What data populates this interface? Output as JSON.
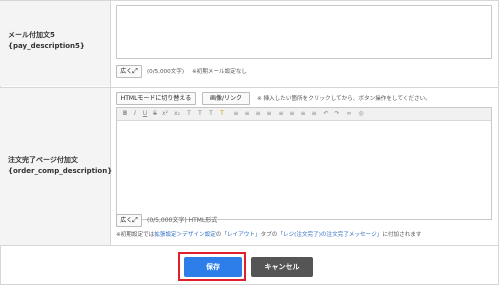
{
  "rows": {
    "mail": {
      "label_line1": "メール付加文5",
      "label_line2": "{pay_description5}",
      "expand_label": "広く",
      "char_count": "(0/5,000文字)",
      "note": "※初期メール設定なし"
    },
    "order": {
      "label_line1": "注文完了ページ付加文",
      "label_line2": "{order_comp_description}",
      "html_mode_button": "HTMLモードに切り替える",
      "image_link_button": "画像/リンク",
      "insert_hint": "※ 挿入したい箇所をクリックしてから、ボタン操作をしてください。",
      "expand_label": "広く",
      "char_count": "(0/5,000文字) HTML形式",
      "footnote_prefix": "※初期設定では",
      "footnote_link1": "拡張設定＞デザイン設定",
      "footnote_mid1": "の",
      "footnote_link2": "「レイアウト」",
      "footnote_mid2": "タブの",
      "footnote_link3": "「レジ(注文完了)の注文完了メッセージ」",
      "footnote_suffix": "に付加されます"
    }
  },
  "toolbar_icons": [
    "B",
    "I",
    "U",
    "S",
    "x²",
    "x₂",
    "T",
    "T",
    "T",
    "T",
    "≡",
    "≡",
    "≡",
    "≡",
    "≡",
    "≡",
    "≡",
    "≡",
    "↶",
    "↷",
    "∞",
    "◎"
  ],
  "toolbar_icon_names": [
    "bold-icon",
    "italic-icon",
    "underline-icon",
    "strikethrough-icon",
    "superscript-icon",
    "subscript-icon",
    "font-size-icon",
    "font-color-icon",
    "text-color-icon",
    "highlight-icon",
    "ordered-list-icon",
    "unordered-list-icon",
    "indent-icon",
    "outdent-icon",
    "align-left-icon",
    "align-center-icon",
    "align-right-icon",
    "align-justify-icon",
    "undo-icon",
    "redo-icon",
    "link-icon",
    "unlink-icon"
  ],
  "actions": {
    "save": "保存",
    "cancel": "キャンセル"
  },
  "colors": {
    "save_bg": "#2d7ee8",
    "cancel_bg": "#555555",
    "highlight_outline": "#e0202a",
    "link": "#2b6cc4"
  }
}
